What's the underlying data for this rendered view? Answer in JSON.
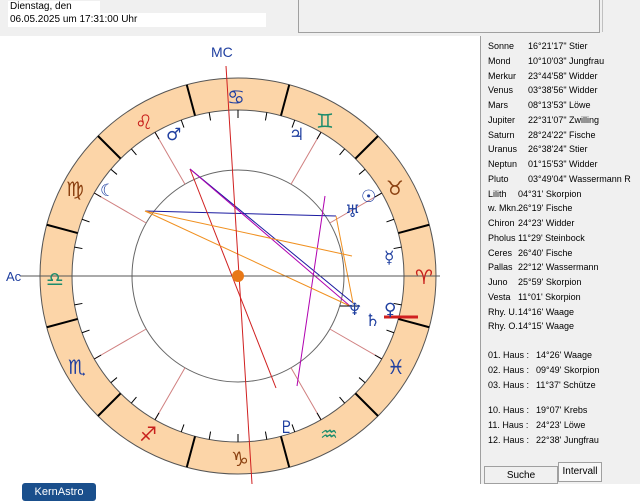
{
  "header": {
    "date_label": "Dienstag, den",
    "date_value": "06.05.2025  um  17:31:00 Uhr"
  },
  "chart": {
    "mc_label": "MC",
    "ac_label": "Ac",
    "logo": "KernAstro",
    "colors": {
      "zodiac_ring": "#fcd5a8",
      "planet_glyph": "#1f3fa0",
      "sign_fire": "#c8201c",
      "sign_water": "#1f3fa0",
      "sign_earth": "#8b4010",
      "sign_air": "#1c8c6c",
      "center_dot": "#e87818"
    },
    "signs": [
      "♈",
      "♉",
      "♊",
      "♋",
      "♌",
      "♍",
      "♎",
      "♏",
      "♐",
      "♑",
      "♒",
      "♓"
    ],
    "planets": {
      "sun": "☉",
      "moon": "☾",
      "mercury": "☿",
      "venus": "♀",
      "mars": "♂",
      "jupiter": "♃",
      "saturn": "♄",
      "uranus": "♅",
      "neptune": "♆",
      "pluto": "♇"
    }
  },
  "positions": [
    {
      "name": "Sonne",
      "value": "16°21'17\" Stier"
    },
    {
      "name": "Mond",
      "value": "10°10'03\" Jungfrau"
    },
    {
      "name": "Merkur",
      "value": "23°44'58\" Widder"
    },
    {
      "name": "Venus",
      "value": "03°38'56\" Widder"
    },
    {
      "name": "Mars",
      "value": "08°13'53\" Löwe"
    },
    {
      "name": "Jupiter",
      "value": "22°31'07\" Zwilling"
    },
    {
      "name": "Saturn",
      "value": "28°24'22\" Fische"
    },
    {
      "name": "Uranus",
      "value": "26°38'24\" Stier"
    },
    {
      "name": "Neptun",
      "value": "01°15'53\" Widder"
    },
    {
      "name": "Pluto",
      "value": "03°49'04\" Wassermann R"
    },
    {
      "name": "Lilith",
      "value": "04°31' Skorpion"
    },
    {
      "name": "w. Mkn.",
      "value": "26°19' Fische"
    },
    {
      "name": "Chiron",
      "value": "24°23' Widder"
    },
    {
      "name": "Pholus",
      "value": "11°29' Steinbock"
    },
    {
      "name": "Ceres",
      "value": "26°40' Fische"
    },
    {
      "name": "Pallas",
      "value": "22°12' Wassermann"
    },
    {
      "name": "Juno",
      "value": "25°59' Skorpion"
    },
    {
      "name": "Vesta",
      "value": "11°01' Skorpion"
    },
    {
      "name": "Rhy. U.",
      "value": "14°16' Waage"
    },
    {
      "name": "Rhy. O.",
      "value": "14°15' Waage"
    }
  ],
  "houses_a": [
    {
      "name": "01. Haus :",
      "value": "14°26' Waage"
    },
    {
      "name": "02. Haus :",
      "value": "09°49' Skorpion"
    },
    {
      "name": "03. Haus :",
      "value": "11°37' Schütze"
    }
  ],
  "houses_b": [
    {
      "name": "10. Haus :",
      "value": "19°07' Krebs"
    },
    {
      "name": "11. Haus :",
      "value": "24°23' Löwe"
    },
    {
      "name": "12. Haus :",
      "value": "22°38' Jungfrau"
    }
  ],
  "buttons": {
    "search": "Suche",
    "interval": "Intervall"
  }
}
